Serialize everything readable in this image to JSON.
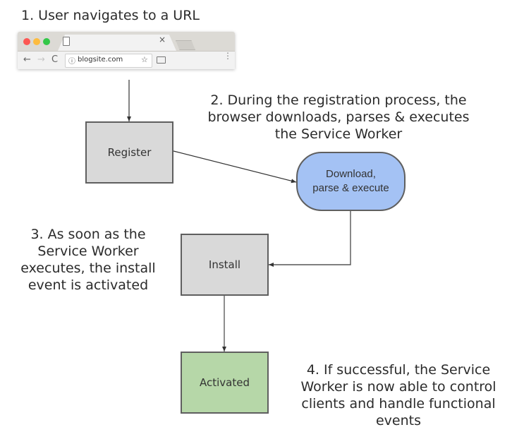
{
  "steps": {
    "step1": {
      "lines": [
        "1.   User navigates to a URL"
      ]
    },
    "step2": {
      "lines": [
        "2. During the registration process, the",
        "browser downloads, parses & executes",
        "the Service Worker"
      ]
    },
    "step3": {
      "lines": [
        "3. As soon as the",
        "Service Worker",
        "executes, the install",
        "event is activated"
      ]
    },
    "step4": {
      "lines": [
        "4. If successful, the Service",
        "Worker is now able to control",
        "clients and handle functional",
        "events"
      ]
    }
  },
  "browser": {
    "url": "blogsite.com",
    "tab_close": "×",
    "icons": {
      "back": "←",
      "forward": "→",
      "reload": "C",
      "info": "ⓘ",
      "star": "☆",
      "menu": "⋮"
    }
  },
  "nodes": {
    "register": {
      "label": "Register"
    },
    "download": {
      "label_lines": [
        "Download,",
        "parse & execute"
      ]
    },
    "install": {
      "label": "Install"
    },
    "activated": {
      "label": "Activated"
    }
  },
  "colors": {
    "process_box": "#d9d9d9",
    "download_box": "#a4c2f4",
    "activated_box": "#b6d7a8",
    "border": "#5f5f5f",
    "connector": "#333333"
  }
}
